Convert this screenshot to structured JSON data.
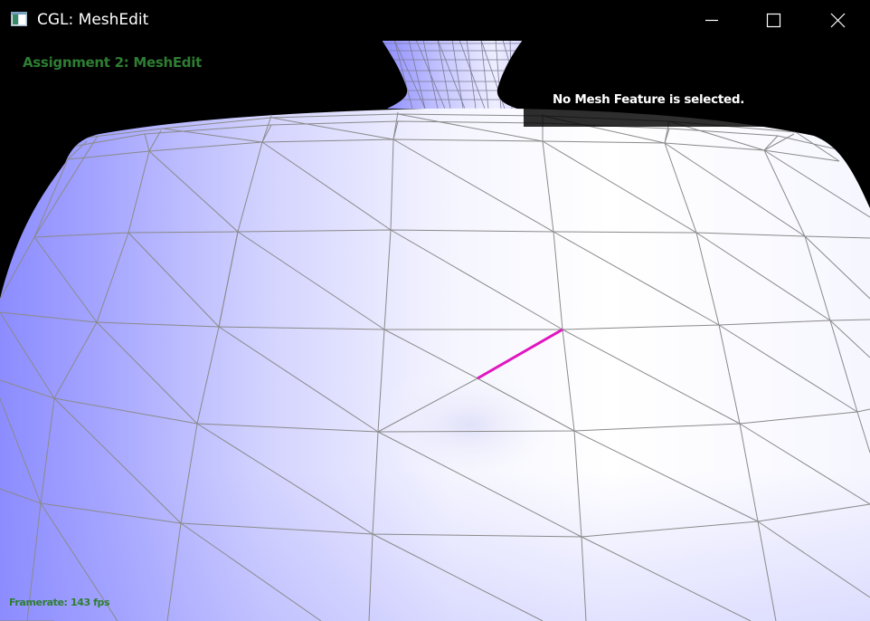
{
  "window": {
    "title": "CGL: MeshEdit",
    "minimize_label": "minimize",
    "maximize_label": "maximize",
    "close_label": "close"
  },
  "overlay": {
    "assignment_title": "Assignment 2: MeshEdit",
    "selection_status": "No Mesh Feature is selected.",
    "framerate": "Framerate: 143 fps"
  },
  "colors": {
    "background": "#000000",
    "overlay_text_green": "#2e7d32",
    "mesh_light": "#ffffff",
    "mesh_shade": "#8c8cff",
    "wireframe": "#8a8a8a",
    "highlighted_edge": "#e016c0"
  },
  "icons": {
    "app": "app-window-icon",
    "minimize": "minimize-icon",
    "maximize": "maximize-icon",
    "close": "close-icon"
  }
}
